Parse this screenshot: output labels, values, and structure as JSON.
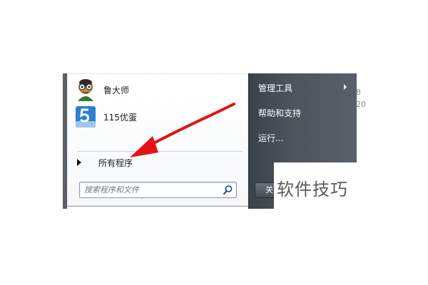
{
  "start_menu": {
    "programs": [
      {
        "label": "鲁大师",
        "icon": "ludashi-icon"
      },
      {
        "label": "115优蛋",
        "icon": "115-icon"
      }
    ],
    "all_programs_label": "所有程序",
    "search": {
      "placeholder": "搜索程序和文件",
      "icon": "search-icon"
    },
    "right_items": [
      {
        "label": "管理工具",
        "has_submenu": true
      },
      {
        "label": "帮助和支持",
        "has_submenu": false
      },
      {
        "label": "运行...",
        "has_submenu": false
      }
    ],
    "shutdown_label": "关"
  },
  "desktop": {
    "fragments": [
      "8",
      "20"
    ]
  },
  "annotation": {
    "color": "#e31313"
  },
  "watermark": "软件技巧"
}
